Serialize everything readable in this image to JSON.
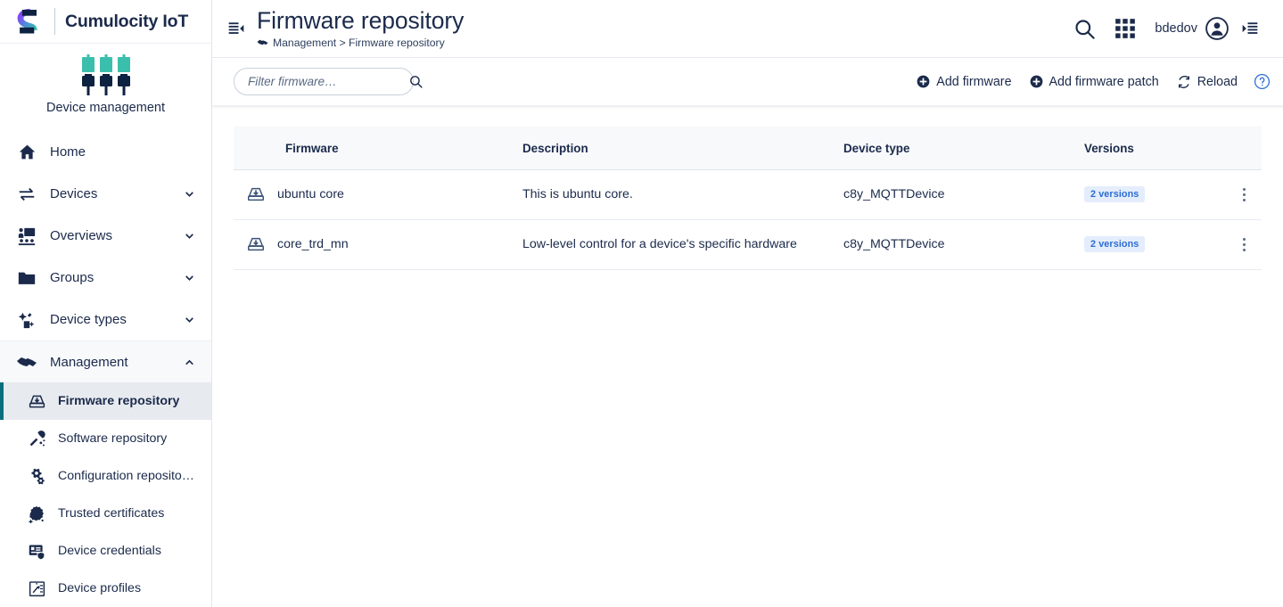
{
  "brand": {
    "logo_icon": "cumulocity-s-logo",
    "name": "Cumulocity IoT",
    "app_icon": "device-management-plugs-icon",
    "app_label": "Device management"
  },
  "sidebar": {
    "items": [
      {
        "label": "Home",
        "icon": "home-icon",
        "expandable": false,
        "key": "home"
      },
      {
        "label": "Devices",
        "icon": "devices-transfer-icon",
        "expandable": true,
        "expanded": false,
        "key": "devices"
      },
      {
        "label": "Overviews",
        "icon": "overviews-presentation-icon",
        "expandable": true,
        "expanded": false,
        "key": "overviews"
      },
      {
        "label": "Groups",
        "icon": "folder-icon",
        "expandable": true,
        "expanded": false,
        "key": "groups"
      },
      {
        "label": "Device types",
        "icon": "device-types-plug-icon",
        "expandable": true,
        "expanded": false,
        "key": "device-types"
      },
      {
        "label": "Management",
        "icon": "handshake-icon",
        "expandable": true,
        "expanded": true,
        "key": "management"
      }
    ],
    "management_children": [
      {
        "label": "Firmware repository",
        "icon": "firmware-archive-icon",
        "active": true,
        "key": "firmware-repository"
      },
      {
        "label": "Software repository",
        "icon": "software-wrench-icon",
        "active": false,
        "key": "software-repository"
      },
      {
        "label": "Configuration reposito…",
        "icon": "configuration-gears-icon",
        "active": false,
        "key": "configuration-repository"
      },
      {
        "label": "Trusted certificates",
        "icon": "certificate-badge-icon",
        "active": false,
        "key": "trusted-certificates"
      },
      {
        "label": "Device credentials",
        "icon": "device-credentials-shield-icon",
        "active": false,
        "key": "device-credentials"
      },
      {
        "label": "Device profiles",
        "icon": "device-profiles-clipboard-icon",
        "active": false,
        "key": "device-profiles"
      }
    ]
  },
  "header": {
    "collapse_icon": "collapse-sidebar-icon",
    "title": "Firmware repository",
    "breadcrumb_icon": "handshake-icon",
    "breadcrumb": "Management > Firmware repository",
    "search_icon": "search-icon",
    "apps_icon": "app-switcher-grid-icon",
    "user_name": "bdedov",
    "user_avatar_icon": "user-avatar-icon",
    "right_drawer_icon": "right-drawer-icon"
  },
  "toolbar": {
    "filter_placeholder": "Filter firmware…",
    "filter_value": "",
    "filter_icon": "search-icon",
    "add_firmware_label": "Add firmware",
    "add_firmware_icon": "plus-circle-icon",
    "add_patch_label": "Add firmware patch",
    "add_patch_icon": "plus-circle-icon",
    "reload_label": "Reload",
    "reload_icon": "refresh-icon",
    "help_icon": "help-question-icon"
  },
  "table": {
    "columns": [
      "Firmware",
      "Description",
      "Device type",
      "Versions"
    ],
    "row_icon": "firmware-archive-icon",
    "row_menu_icon": "kebab-menu-icon",
    "rows": [
      {
        "firmware": "ubuntu core",
        "description": "This is ubuntu core.",
        "device_type": "c8y_MQTTDevice",
        "versions": "2 versions"
      },
      {
        "firmware": "core_trd_mn",
        "description": "Low-level control for a device's specific hardware",
        "device_type": "c8y_MQTTDevice",
        "versions": "2 versions"
      }
    ]
  },
  "colors": {
    "navy": "#1b2a4b",
    "accent_teal": "#0b6e7f",
    "badge_bg": "#e4edfb",
    "badge_text": "#2b6cd4",
    "link_blue": "#2b6cd4",
    "logo_purple": "#8a3ffc",
    "logo_teal": "#3bbfad"
  }
}
